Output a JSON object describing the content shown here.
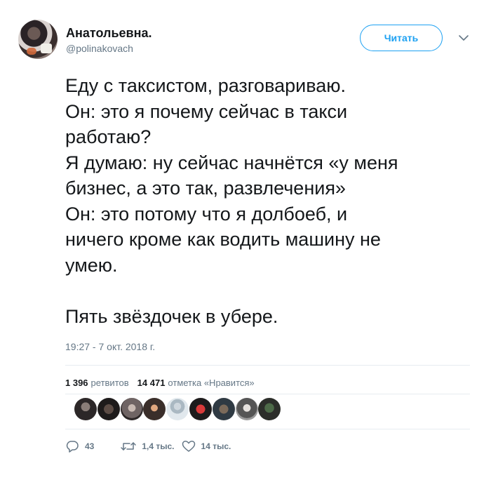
{
  "user": {
    "name": "Анатольевна.",
    "handle": "@polinakovach"
  },
  "follow_button": {
    "label": "Читать"
  },
  "tweet": {
    "text": "Еду с таксистом, разговариваю.\nОн: это я почему сейчас в такси\nработаю?\nЯ думаю: ну сейчас начнётся «у меня\nбизнес, а это так, развлечения»\nОн: это потому что я долбоеб, и\nничего кроме как водить машину не\nумею.\n\nПять звёздочек в убере.",
    "timestamp": "19:27 - 7 окт. 2018 г."
  },
  "stats": {
    "retweets_count": "1 396",
    "retweets_label": "ретвитов",
    "likes_count": "14 471",
    "likes_label": "отметка «Нравится»"
  },
  "actions": {
    "replies": "43",
    "retweets": "1,4 тыс.",
    "likes": "14 тыс."
  },
  "colors": {
    "accent": "#1da1f2",
    "secondary_text": "#657786",
    "primary_text": "#14171a",
    "divider": "#e6ecf0"
  },
  "icons": [
    "chevron-down-icon",
    "reply-icon",
    "retweet-icon",
    "like-icon"
  ]
}
